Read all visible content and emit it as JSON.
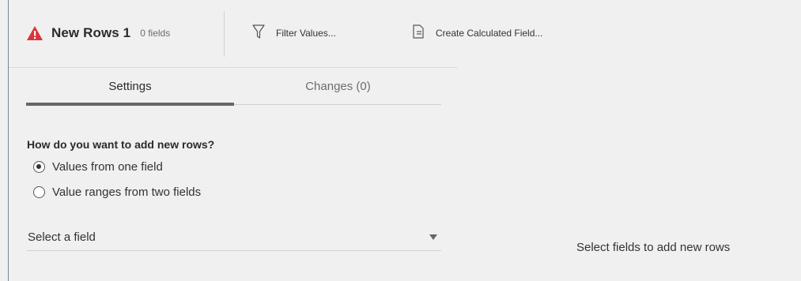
{
  "toolbar": {
    "step_name": "New Rows 1",
    "field_count": "0 fields",
    "status_icon": "warning-icon",
    "status_color": "#d9343a",
    "actions": [
      {
        "label": "Filter Values...",
        "icon": "filter-icon"
      },
      {
        "label": "Create Calculated Field...",
        "icon": "calculated-field-icon"
      }
    ]
  },
  "tabs": [
    {
      "label": "Settings",
      "active": true
    },
    {
      "label": "Changes (0)",
      "active": false
    }
  ],
  "settings": {
    "question": "How do you want to add new rows?",
    "options": [
      {
        "label": "Values from one field",
        "selected": true
      },
      {
        "label": "Value ranges from two fields",
        "selected": false
      }
    ],
    "field_select": {
      "value": "Select a field"
    }
  },
  "canvas": {
    "hint": "Select fields to add new rows"
  }
}
